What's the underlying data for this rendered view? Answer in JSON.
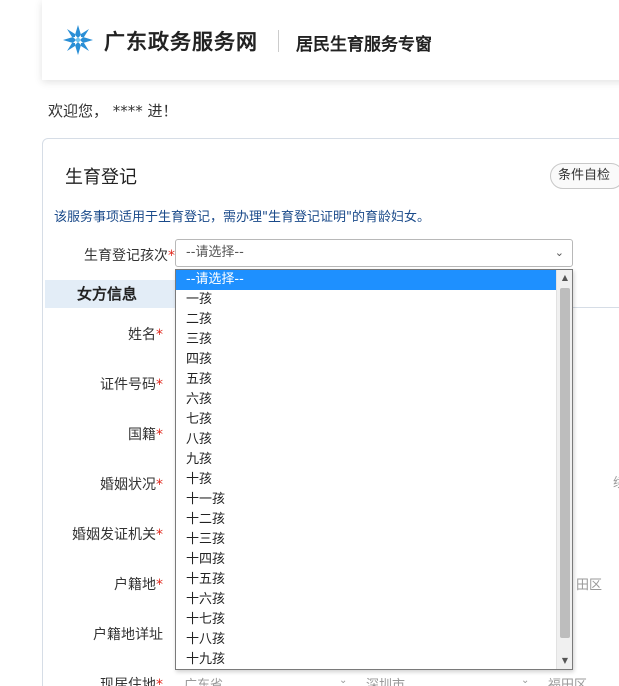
{
  "header": {
    "site_name": "广东政务服务网",
    "sub_name": "居民生育服务专窗",
    "logo_icon": "snowflake-star-icon"
  },
  "welcome": "欢迎您， **** 进！",
  "form": {
    "title": "生育登记",
    "self_check_button": "条件自检",
    "notice": "该服务事项适用于生育登记，需办理\"生育登记证明\"的育龄妇女。",
    "birth_order": {
      "label": "生育登记孩次",
      "required_mark": "*",
      "value": "--请选择--",
      "options": [
        "--请选择--",
        "一孩",
        "二孩",
        "三孩",
        "四孩",
        "五孩",
        "六孩",
        "七孩",
        "八孩",
        "九孩",
        "十孩",
        "十一孩",
        "十二孩",
        "十三孩",
        "十四孩",
        "十五孩",
        "十六孩",
        "十七孩",
        "十八孩",
        "十九孩"
      ],
      "selected_index": 0
    },
    "section_tab": "女方信息",
    "fields": [
      {
        "label": "姓名",
        "required": "*"
      },
      {
        "label": "证件号码",
        "required": "*"
      },
      {
        "label": "国籍",
        "required": "*"
      },
      {
        "label": "婚姻状况",
        "required": "*"
      },
      {
        "label": "婚姻发证机关",
        "required": "*"
      },
      {
        "label": "户籍地",
        "required": "*"
      },
      {
        "label": "户籍地详址",
        "required": ""
      },
      {
        "label": "现居住地",
        "required": "*"
      }
    ],
    "background_fragments": {
      "right_char": "续",
      "household_district": "田区",
      "residence_province": "广东省",
      "residence_city": "深圳市",
      "residence_district": "福田区"
    }
  }
}
